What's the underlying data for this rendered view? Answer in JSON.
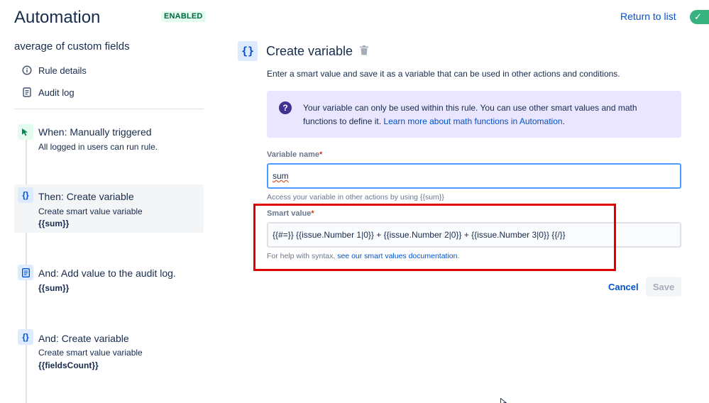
{
  "header": {
    "title": "Automation",
    "status_badge": "ENABLED",
    "return_link": "Return to list",
    "toggle_state": "on"
  },
  "sidebar": {
    "rule_name": "average of custom fields",
    "links": [
      {
        "label": "Rule details",
        "icon": "info-icon"
      },
      {
        "label": "Audit log",
        "icon": "document-icon"
      }
    ],
    "steps": [
      {
        "title": "When: Manually triggered",
        "subtitle": "All logged in users can run rule.",
        "variable": "",
        "icon": "trigger-icon",
        "active": false
      },
      {
        "title": "Then: Create variable",
        "subtitle": "Create smart value variable",
        "variable": "{{sum}}",
        "icon": "braces-icon",
        "active": true
      },
      {
        "title": "And: Add value to the audit log.",
        "subtitle": "",
        "variable": "{{sum}}",
        "icon": "audit-log-icon",
        "active": false
      },
      {
        "title": "And: Create variable",
        "subtitle": "Create smart value variable",
        "variable": "{{fieldsCount}}",
        "icon": "braces-icon",
        "active": false
      }
    ]
  },
  "main": {
    "icon_glyph": "{}",
    "title": "Create variable",
    "description": "Enter a smart value and save it as a variable that can be used in other actions and conditions.",
    "info": {
      "text": "Your variable can only be used within this rule. You can use other smart values and math functions to define it. ",
      "link": "Learn more about math functions in Automation",
      "suffix": "."
    },
    "variable_name": {
      "label": "Variable name",
      "required_mark": "*",
      "value": "sum",
      "helper": "Access your variable in other actions by using {{sum}}"
    },
    "smart_value": {
      "label": "Smart value",
      "required_mark": "*",
      "value": "{{#=}} {{issue.Number 1|0}} + {{issue.Number 2|0}} + {{issue.Number 3|0}} {{/}}",
      "helper_prefix": "For help with syntax, ",
      "helper_link": "see our smart values documentation",
      "helper_suffix": "."
    },
    "buttons": {
      "cancel": "Cancel",
      "save": "Save"
    }
  },
  "colors": {
    "accent": "#0052cc",
    "enabled_green": "#36b37e",
    "highlight_red": "#e00000",
    "info_bg": "#eae6ff"
  }
}
